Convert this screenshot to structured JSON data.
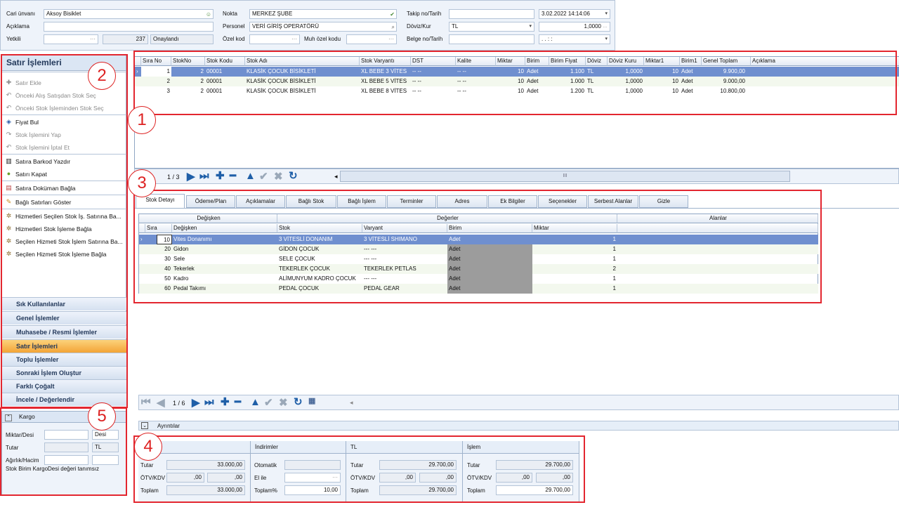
{
  "header": {
    "cari_label": "Cari ünvanı",
    "cari_value": "Aksoy Bisiklet",
    "aciklama_label": "Açıklama",
    "aciklama_value": "",
    "yetkili_label": "Yetkili",
    "yetkili_dots": "···",
    "yetkili_count": "237",
    "yetkili_status": "Onaylandı",
    "nokta_label": "Nokta",
    "nokta_value": "MERKEZ ŞUBE",
    "personel_label": "Personel",
    "personel_value": "VERİ GİRİŞ OPERATÖRÜ",
    "ozelkod_label": "Özel kod",
    "ozelkod_dots": "···",
    "muhozel_label": "Muh özel kodu",
    "muhozel_dots": "···",
    "takip_label": "Takip no/Tarih",
    "takip_date": "3.02.2022 14:14:06",
    "doviz_label": "Döviz/Kur",
    "doviz_value": "TL",
    "kur_value": "1,0000",
    "belge_label": "Belge no/Tarih",
    "belge_date": ". .   : :"
  },
  "left_panel": {
    "title": "Satır İşlemleri",
    "items": [
      {
        "label": "Satır Ekle",
        "icon": "plus-icon",
        "disabled": true
      },
      {
        "label": "Önceki Alış Satışdan Stok Seç",
        "icon": "undo-icon",
        "disabled": true
      },
      {
        "label": "Önceki Stok İşleminden Stok Seç",
        "icon": "undo-icon",
        "disabled": true
      },
      {
        "label": "Fiyat Bul",
        "icon": "price-tag-icon",
        "disabled": false
      },
      {
        "label": "Stok İşlemini Yap",
        "icon": "redo-icon",
        "disabled": true
      },
      {
        "label": "Stok İşlemini İptal Et",
        "icon": "undo-icon",
        "disabled": true
      },
      {
        "label": "Satıra Barkod Yazdır",
        "icon": "barcode-icon",
        "disabled": false
      },
      {
        "label": "Satırı Kapat",
        "icon": "check-circle-icon",
        "disabled": false
      },
      {
        "label": "Satıra Doküman Bağla",
        "icon": "document-icon",
        "disabled": false
      },
      {
        "label": "Bağlı Satırları Göster",
        "icon": "link-icon",
        "disabled": false
      },
      {
        "label": "Hizmetleri Seçilen Stok İş. Satırına Ba...",
        "icon": "gears-icon",
        "disabled": false
      },
      {
        "label": "Hizmetleri Stok İşleme Bağla",
        "icon": "gears-icon",
        "disabled": false
      },
      {
        "label": "Seçilen Hizmeti Stok İşlem Satırına Ba...",
        "icon": "gears-icon",
        "disabled": false
      },
      {
        "label": "Seçilen Hizmeti Stok İşleme Bağla",
        "icon": "gears-icon",
        "disabled": false
      }
    ],
    "nav": [
      "Sık Kullanılanlar",
      "Genel İşlemler",
      "Muhasebe / Resmi İşlemler",
      "Satır İşlemleri",
      "Toplu İşlemler",
      "Sonraki İşlem Oluştur",
      "Farklı Çoğalt",
      "İncele / Değerlendir"
    ],
    "active_nav": "Satır İşlemleri"
  },
  "kargo": {
    "title": "Kargo",
    "miktar_label": "Miktar/Desi",
    "desi": "Desi",
    "tutar_label": "Tutar",
    "currency": "TL",
    "agirlik_label": "Ağırlık/Hacim",
    "note": "Stok Birim KargoDesi değeri tanımsız"
  },
  "main_grid": {
    "columns": [
      "Sıra No",
      "StokNo",
      "Stok Kodu",
      "Stok Adı",
      "Stok Varyantı",
      "DST",
      "Kalite",
      "Miktar",
      "Birim",
      "Birim Fiyat",
      "Döviz",
      "Döviz Kuru",
      "Miktar1",
      "Birim1",
      "Genel Toplam",
      "Açıklama"
    ],
    "rows": [
      [
        "1",
        "2",
        "00001",
        "KLASİK ÇOCUK BİSİKLETİ",
        "XL BEBE 3 VİTES",
        "-- --",
        "-- --",
        "10",
        "Adet",
        "1.100",
        "TL",
        "1,0000",
        "10",
        "Adet",
        "9.900,00",
        ""
      ],
      [
        "2",
        "2",
        "00001",
        "KLASİK ÇOCUK BİSİKLETİ",
        "XL BEBE 5 VİTES",
        "-- --",
        "-- --",
        "10",
        "Adet",
        "1.000",
        "TL",
        "1,0000",
        "10",
        "Adet",
        "9.000,00",
        ""
      ],
      [
        "3",
        "2",
        "00001",
        "KLASİK ÇOCUK BİSİKLETİ",
        "XL BEBE 8 VİTES",
        "-- --",
        "-- --",
        "10",
        "Adet",
        "1.200",
        "TL",
        "1,0000",
        "10",
        "Adet",
        "10.800,00",
        ""
      ]
    ],
    "pager": "1 / 3",
    "scroll_grip": "III"
  },
  "tabs": [
    "Stok Detayı",
    "Ödeme/Plan",
    "Açıklamalar",
    "Bağlı Stok",
    "Bağlı İşlem",
    "Terminler",
    "Adres",
    "Ek Bilgiler",
    "Seçenekler",
    "Serbest Alanlar",
    "Gizle"
  ],
  "active_tab": "Stok Detayı",
  "detail_grid": {
    "band_degisken": "Değişken",
    "band_degerler": "Değerler",
    "band_alanlar": "Alanlar",
    "columns": [
      "Sıra",
      "Değişken",
      "Stok",
      "Varyant",
      "Birim",
      "Miktar"
    ],
    "rows": [
      [
        "10",
        "Vites Donanımı",
        "3 VİTESLİ DONANIM",
        "3 VİTESLİ SHIMANO",
        "Adet",
        "1"
      ],
      [
        "20",
        "Gidon",
        "GİDON ÇOCUK",
        "--- ---",
        "Adet",
        "1"
      ],
      [
        "30",
        "Sele",
        "SELE ÇOCUK",
        "--- ---",
        "Adet",
        "1"
      ],
      [
        "40",
        "Tekerlek",
        "TEKERLEK ÇOCUK",
        "TEKERLEK PETLAS",
        "Adet",
        "2"
      ],
      [
        "50",
        "Kadro",
        "ALİMUNYUM KADRO ÇOCUK",
        "--- ---",
        "Adet",
        "1"
      ],
      [
        "60",
        "Pedal Takımı",
        "PEDAL ÇOCUK",
        "PEDAL GEAR",
        "Adet",
        "1"
      ]
    ],
    "pager": "1 / 6"
  },
  "ayrintilar": "Ayrıntılar",
  "summary": {
    "col1": {
      "head": "",
      "tutar_label": "Tutar",
      "tutar": "33.000,00",
      "otv_label": "ÖTV/KDV",
      "otv": ",00",
      "kdv": ",00",
      "toplam_label": "Toplam",
      "toplam": "33.000,00"
    },
    "col2": {
      "head": "İndirimler",
      "otomatik_label": "Otomatik",
      "elile_label": "El ile",
      "elile_dots": "···",
      "toplam_label": "Toplam%",
      "toplam": "10,00"
    },
    "col3": {
      "head": "TL",
      "tutar_label": "Tutar",
      "tutar": "29.700,00",
      "otv_label": "ÖTV/KDV",
      "otv": ",00",
      "kdv": ",00",
      "toplam_label": "Toplam",
      "toplam": "29.700,00"
    },
    "col4": {
      "head": "İşlem",
      "tutar_label": "Tutar",
      "tutar": "29.700,00",
      "otv_label": "ÖTV/KDV",
      "otv": ",00",
      "kdv": ",00",
      "toplam_label": "Toplam",
      "toplam": "29.700,00"
    }
  },
  "annotations": [
    "1",
    "2",
    "3",
    "4",
    "5"
  ],
  "colors": {
    "highlight_red": "#e3262f",
    "selected_row": "#6f8fcf",
    "active_nav": "#f3a436"
  }
}
